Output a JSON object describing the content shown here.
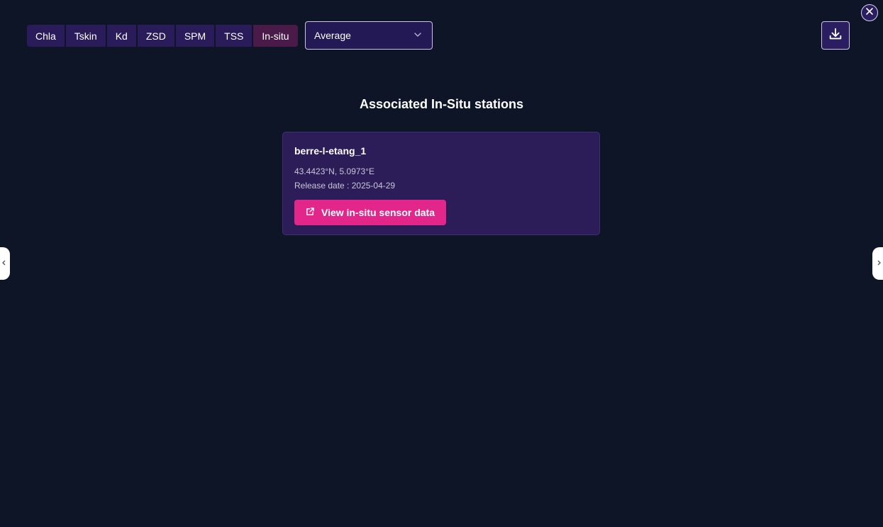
{
  "tabs": [
    {
      "label": "Chla",
      "active": false
    },
    {
      "label": "Tskin",
      "active": false
    },
    {
      "label": "Kd",
      "active": false
    },
    {
      "label": "ZSD",
      "active": false
    },
    {
      "label": "SPM",
      "active": false
    },
    {
      "label": "TSS",
      "active": false
    },
    {
      "label": "In-situ",
      "active": true
    }
  ],
  "aggregation_select": {
    "value": "Average",
    "icon": "chevron-down-icon"
  },
  "download_button": {
    "icon": "download-icon"
  },
  "close_button": {
    "icon": "close-icon"
  },
  "section_title": "Associated In-Situ stations",
  "stations": [
    {
      "name": "berre-l-etang_1",
      "coordinates": "43.4423°N, 5.0973°E",
      "release_date": "Release date : 2025-04-29",
      "action_label": "View in-situ sensor data",
      "action_icon": "external-link-icon"
    }
  ],
  "colors": {
    "background": "#0e1526",
    "tab": "#2a1b5a",
    "tab_active": "#4a1a48",
    "card": "#2c1c58",
    "accent": "#e3268a"
  }
}
